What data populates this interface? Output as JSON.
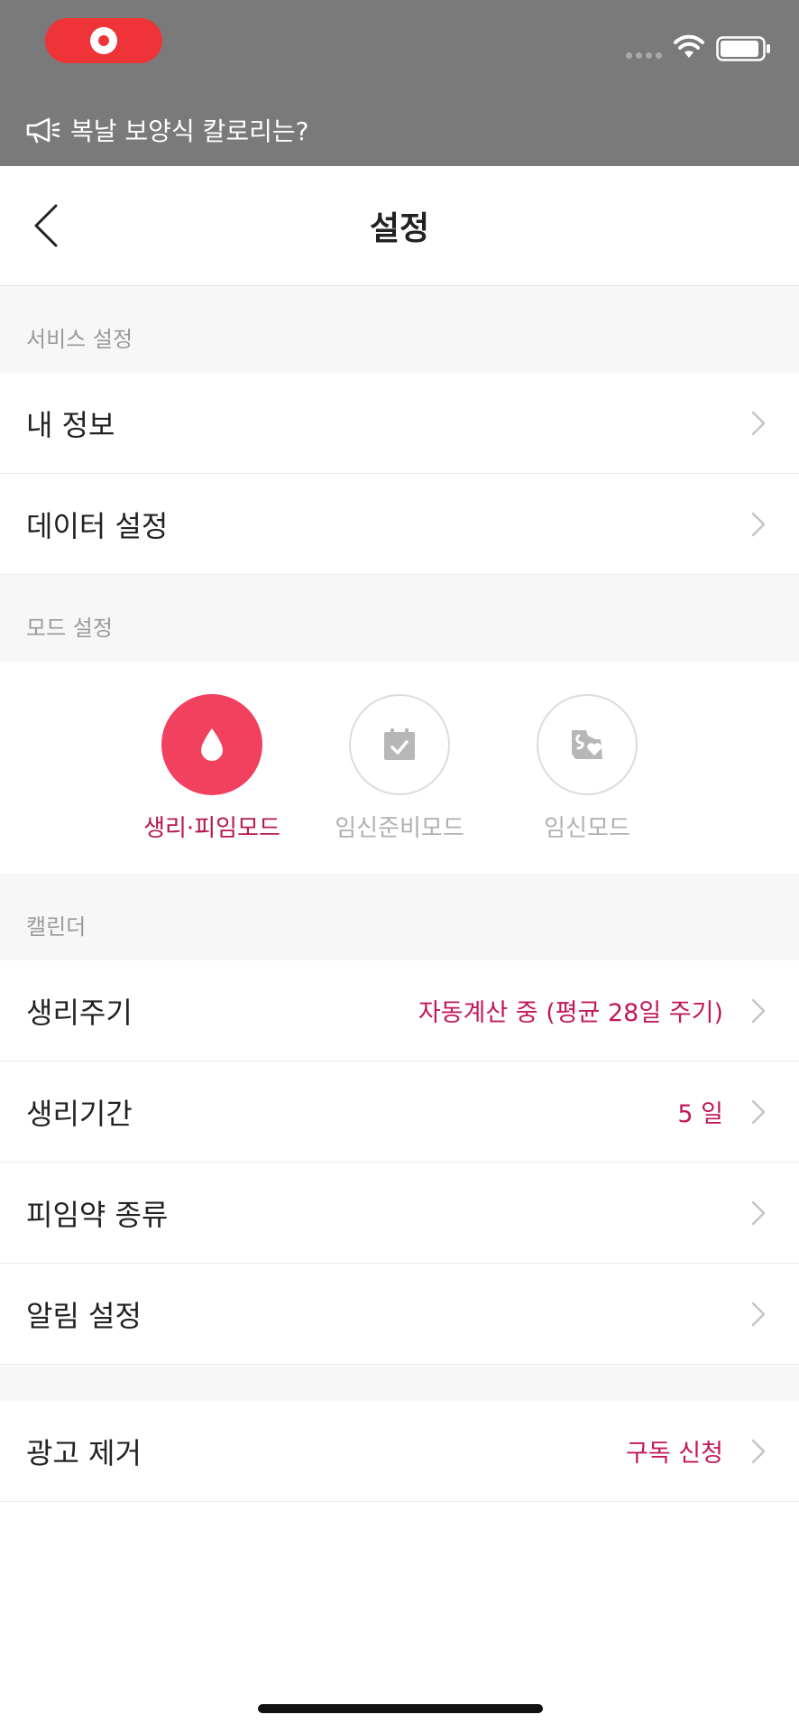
{
  "status": {
    "ticker_text": "복날 보양식 칼로리는?"
  },
  "nav": {
    "title": "설정"
  },
  "sections": {
    "service_header": "서비스 설정",
    "mode_header": "모드 설정",
    "calendar_header": "캘린더"
  },
  "service_items": [
    {
      "label": "내 정보"
    },
    {
      "label": "데이터 설정"
    }
  ],
  "modes": [
    {
      "label": "생리·피임모드",
      "icon": "drop-icon",
      "active": true
    },
    {
      "label": "임신준비모드",
      "icon": "calendar-check-icon",
      "active": false
    },
    {
      "label": "임신모드",
      "icon": "baby-heart-icon",
      "active": false
    }
  ],
  "calendar_items": [
    {
      "label": "생리주기",
      "value": "자동계산 중 (평균 28일 주기)"
    },
    {
      "label": "생리기간",
      "value": "5 일"
    },
    {
      "label": "피임약 종류",
      "value": ""
    },
    {
      "label": "알림 설정",
      "value": ""
    }
  ],
  "ad_item": {
    "label": "광고 제거",
    "value": "구독 신청"
  },
  "colors": {
    "accent": "#c2185b",
    "active_mode": "#f2405f",
    "status_bg": "#7a7a7a",
    "record": "#ee3438"
  }
}
